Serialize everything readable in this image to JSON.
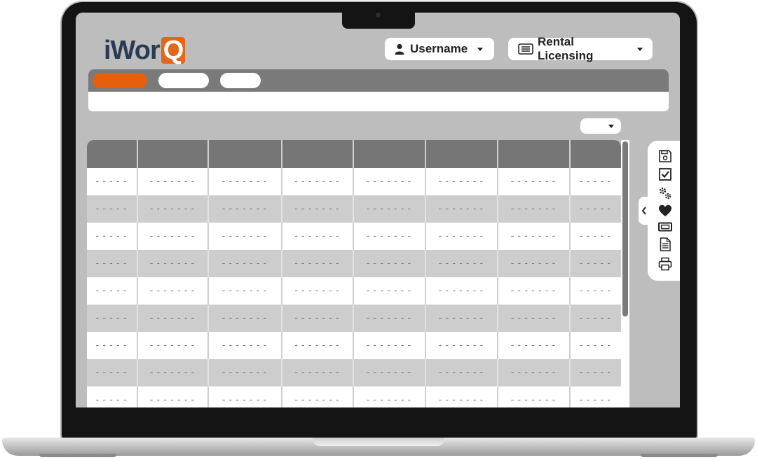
{
  "header": {
    "logo_prefix": "iWor",
    "logo_suffix": "Q",
    "user_label": "Username",
    "module_label": "Rental Licensing"
  },
  "tabs": [
    {
      "label": "",
      "active": true
    },
    {
      "label": "",
      "active": false
    },
    {
      "label": "",
      "active": false
    }
  ],
  "table": {
    "columns": 8,
    "rows": [
      [
        "-----",
        "-------",
        "-------",
        "-------",
        "-------",
        "-------",
        "-------",
        "-----"
      ],
      [
        "-----",
        "-------",
        "-------",
        "-------",
        "-------",
        "-------",
        "-------",
        "-----"
      ],
      [
        "-----",
        "-------",
        "-------",
        "-------",
        "-------",
        "-------",
        "-------",
        "-----"
      ],
      [
        "-----",
        "-------",
        "-------",
        "-------",
        "-------",
        "-------",
        "-------",
        "-----"
      ],
      [
        "-----",
        "-------",
        "-------",
        "-------",
        "-------",
        "-------",
        "-------",
        "-----"
      ],
      [
        "-----",
        "-------",
        "-------",
        "-------",
        "-------",
        "-------",
        "-------",
        "-----"
      ],
      [
        "-----",
        "-------",
        "-------",
        "-------",
        "-------",
        "-------",
        "-------",
        "-----"
      ],
      [
        "-----",
        "-------",
        "-------",
        "-------",
        "-------",
        "-------",
        "-------",
        "-----"
      ],
      [
        "-----",
        "-------",
        "-------",
        "-------",
        "-------",
        "-------",
        "-------",
        "-----"
      ]
    ]
  },
  "toolbar_icons": [
    "save-icon",
    "checkbox-icon",
    "gears-icon",
    "heart-icon",
    "ticket-icon",
    "document-icon",
    "print-icon"
  ],
  "colors": {
    "accent": "#e5600c",
    "tabbar": "#7a7a7a",
    "screen_bg": "#bdbdbd"
  }
}
